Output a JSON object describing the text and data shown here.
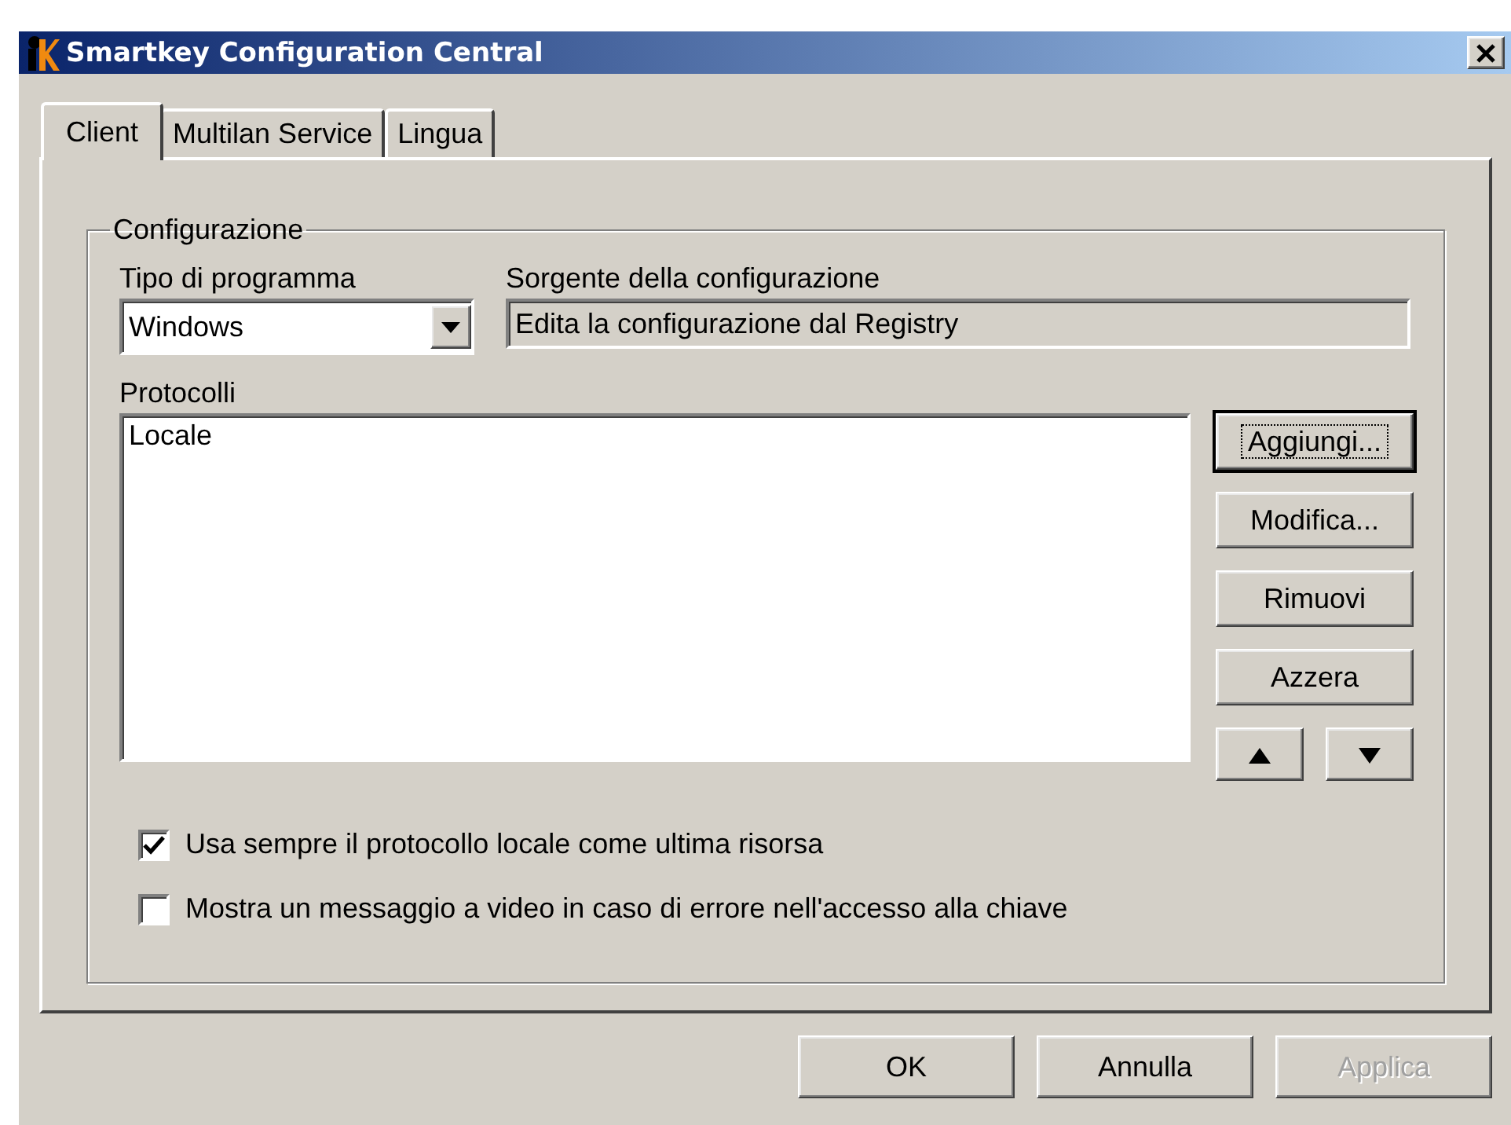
{
  "window": {
    "title": "Smartkey Configuration Central"
  },
  "tabs": [
    {
      "label": "Client",
      "selected": true
    },
    {
      "label": "Multilan Service",
      "selected": false
    },
    {
      "label": "Lingua",
      "selected": false
    }
  ],
  "group": {
    "title": "Configurazione"
  },
  "program_type": {
    "label": "Tipo di programma",
    "value": "Windows"
  },
  "config_source": {
    "label": "Sorgente della configurazione",
    "value": "Edita la configurazione dal Registry"
  },
  "protocols": {
    "label": "Protocolli",
    "items": [
      {
        "label": "Locale",
        "selected": false
      }
    ]
  },
  "side_buttons": [
    {
      "label": "Aggiungi...",
      "focused": true
    },
    {
      "label": "Modifica...",
      "focused": false
    },
    {
      "label": "Rimuovi",
      "focused": false
    },
    {
      "label": "Azzera",
      "focused": false
    }
  ],
  "move_buttons": [
    {
      "kind": "up"
    },
    {
      "kind": "down"
    }
  ],
  "options": [
    {
      "label": "Usa sempre il protocollo locale come ultima risorsa",
      "checked": true
    },
    {
      "label": "Mostra un messaggio a video in caso di errore nell'accesso alla chiave",
      "checked": false
    }
  ],
  "buttons": [
    {
      "label": "OK",
      "disabled": false
    },
    {
      "label": "Annulla",
      "disabled": false
    },
    {
      "label": "Applica",
      "disabled": true
    }
  ]
}
